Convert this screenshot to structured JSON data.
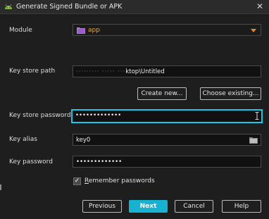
{
  "window": {
    "title": "Generate Signed Bundle or APK",
    "close_glyph": "✕",
    "app_icon": "android-icon",
    "accent_color": "#17c9e6"
  },
  "module": {
    "label": "Module",
    "value": "app",
    "icon": "folder-icon"
  },
  "key_store_path": {
    "label": "Key store path",
    "value_obscured": "·········  ·····  ···",
    "value_visible": "ktop\\Untitled"
  },
  "buttons": {
    "create_new": "Create new...",
    "choose_existing": "Choose existing...",
    "previous": "Previous",
    "next": "Next",
    "cancel": "Cancel",
    "help": "Help"
  },
  "key_store_password": {
    "label": "Key store password",
    "value": "•••••••••••••"
  },
  "key_alias": {
    "label": "Key alias",
    "value": "key0"
  },
  "key_password": {
    "label": "Key password",
    "value": "•••••••••••••"
  },
  "remember": {
    "checked": true,
    "check_glyph": "✓",
    "mnemonic": "R",
    "rest": "emember passwords"
  }
}
